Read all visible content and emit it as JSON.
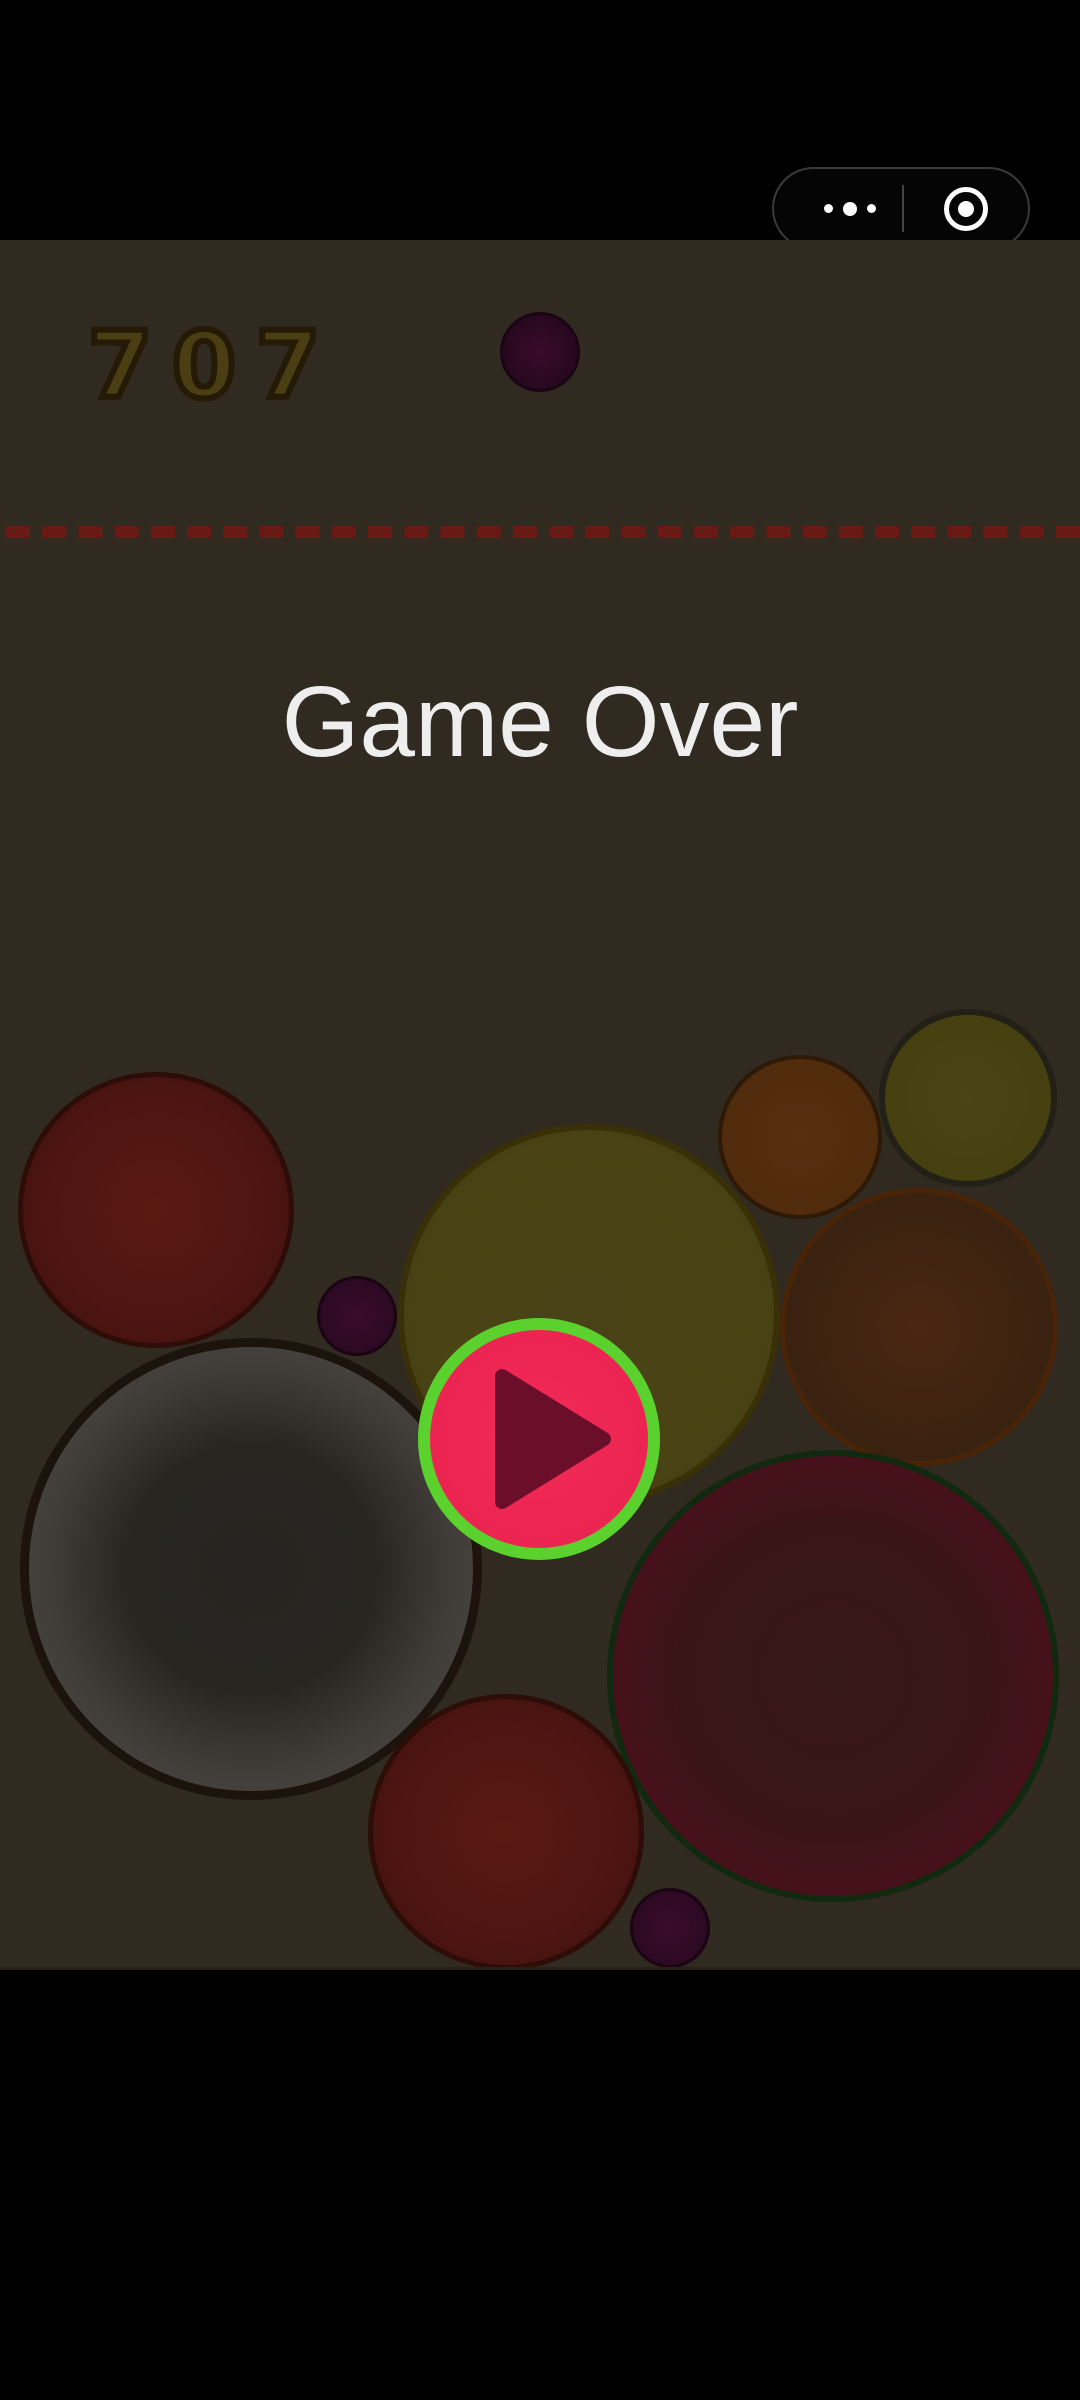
{
  "hud": {
    "score": "707"
  },
  "overlay": {
    "title": "Game Over"
  },
  "capsule": {
    "more_icon": "more-dots-icon",
    "close_icon": "close-circle-icon"
  },
  "play_button": {
    "icon": "play-icon",
    "ring_color": "#5bd12d",
    "fill_color": "#ec2452"
  },
  "fruits": [
    {
      "kind": "grape",
      "name": "next-fruit-grape"
    },
    {
      "kind": "tomato"
    },
    {
      "kind": "grape"
    },
    {
      "kind": "coconut"
    },
    {
      "kind": "cantaloupe"
    },
    {
      "kind": "orange"
    },
    {
      "kind": "lemon"
    },
    {
      "kind": "peach"
    },
    {
      "kind": "watermelon"
    },
    {
      "kind": "tomato"
    },
    {
      "kind": "grape"
    }
  ]
}
